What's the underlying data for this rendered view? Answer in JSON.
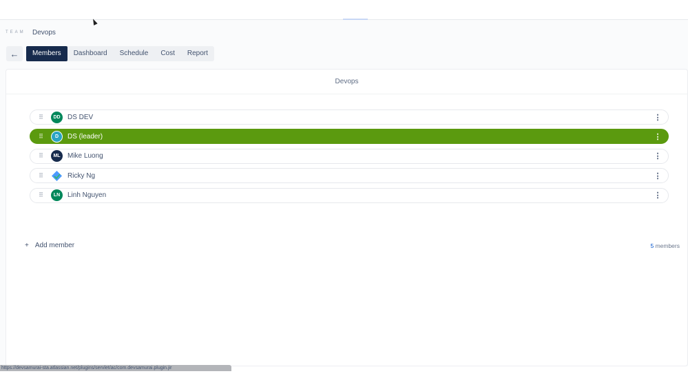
{
  "header": {
    "team_label": "TEAM",
    "team_name": "Devops"
  },
  "tabs": [
    {
      "label": "Members",
      "active": true
    },
    {
      "label": "Dashboard"
    },
    {
      "label": "Schedule"
    },
    {
      "label": "Cost"
    },
    {
      "label": "Report"
    }
  ],
  "card": {
    "title": "Devops"
  },
  "members": [
    {
      "initials": "DD",
      "name": "DS DEV",
      "color": "#00875a"
    },
    {
      "initials": "D",
      "name": "DS (leader)",
      "color": "#2aa4c4",
      "selected": true
    },
    {
      "initials": "ML",
      "name": "Mike Luong",
      "color": "#172b4d"
    },
    {
      "initials": "",
      "name": "Ricky Ng",
      "color": "#4c9aff"
    },
    {
      "initials": "LN",
      "name": "Linh Nguyen",
      "color": "#00875a"
    }
  ],
  "footer": {
    "add_label": "Add member",
    "add_icon": "+",
    "count": "5",
    "count_suffix": "members"
  },
  "status_url": "https://devsamurai-sta.atlassian.net/plugins/servlet/ac/com.devsamurai.plugin.jir"
}
